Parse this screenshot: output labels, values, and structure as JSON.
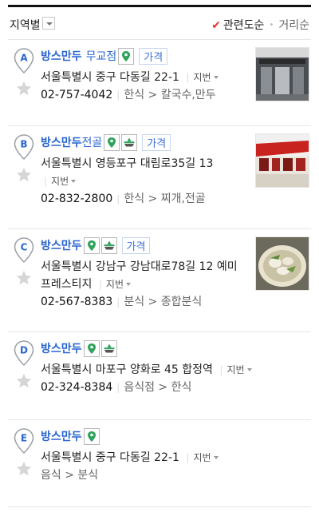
{
  "filters": {
    "region_label": "지역별",
    "sort_relevance": "관련도순",
    "sort_distance": "거리순"
  },
  "results": [
    {
      "marker": "A",
      "name": "방스만두",
      "name_suffix": "무교점",
      "icons": [
        "pin-green-icon"
      ],
      "price_label": "가격",
      "address": "서울특별시 중구 다동길 22-1",
      "jibun_label": "지번",
      "phone": "02-757-4042",
      "category": "한식 > 칼국수,만두"
    },
    {
      "marker": "B",
      "name": "방스만두",
      "name_suffix": "전골",
      "icons": [
        "pin-green-icon",
        "bowl-icon"
      ],
      "price_label": "가격",
      "address": "서울특별시 영등포구 대림로35길 13",
      "jibun_label": "지번",
      "phone": "02-832-2800",
      "category": "한식 > 찌개,전골"
    },
    {
      "marker": "C",
      "name": "방스만두",
      "name_suffix": "",
      "icons": [
        "pin-green-icon",
        "bowl-icon"
      ],
      "price_label": "가격",
      "address": "서울특별시 강남구 강남대로78길 12 예미프레스티지",
      "jibun_label": "지번",
      "phone": "02-567-8383",
      "category": "분식 > 종합분식"
    },
    {
      "marker": "D",
      "name": "방스만두",
      "name_suffix": "",
      "icons": [
        "pin-green-icon",
        "bowl-icon"
      ],
      "price_label": "",
      "address": "서울특별시 마포구 양화로 45 합정역",
      "jibun_label": "지번",
      "phone": "02-324-8384",
      "category": "음식점 > 한식"
    },
    {
      "marker": "E",
      "name": "방스만두",
      "name_suffix": "",
      "icons": [
        "pin-green-icon"
      ],
      "price_label": "",
      "address": "서울특별시 중구 다동길 22-1",
      "jibun_label": "지번",
      "phone": "",
      "category": "음식 > 분식"
    }
  ],
  "colors": {
    "link_blue": "#2a66cf",
    "check_red": "#e8342c",
    "icon_green": "#2fa35a"
  }
}
